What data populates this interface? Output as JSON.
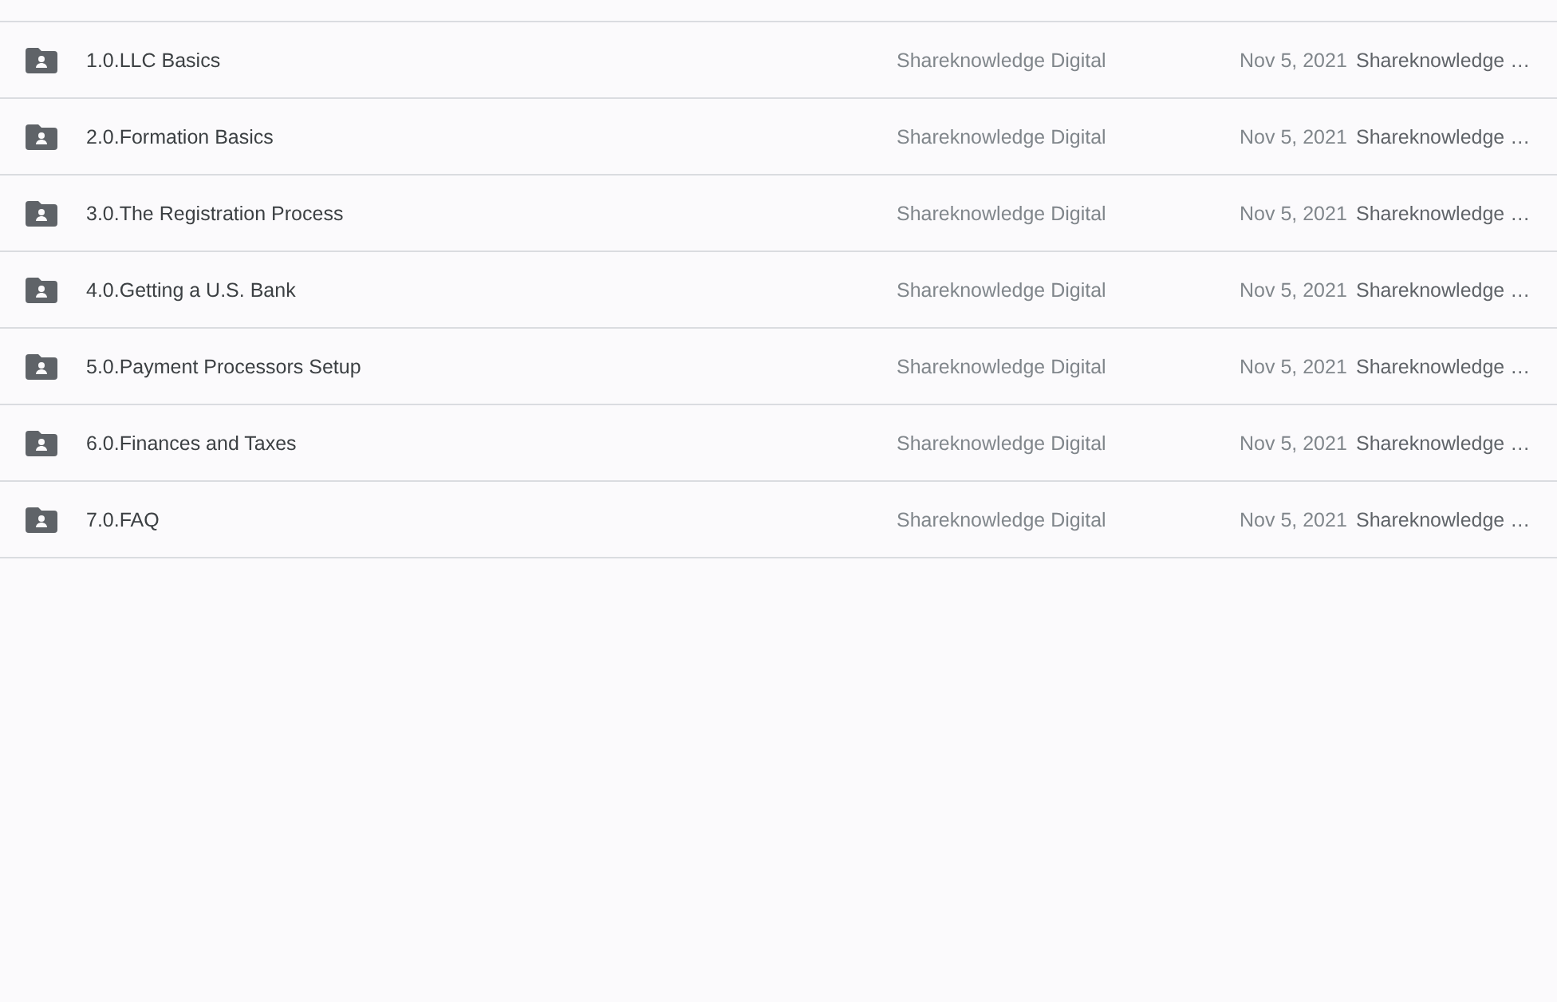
{
  "rows": [
    {
      "name": "1.0.LLC Basics",
      "owner": "Shareknowledge Digital",
      "date": "Nov 5, 2021",
      "modified_by": "Shareknowledge …"
    },
    {
      "name": "2.0.Formation Basics",
      "owner": "Shareknowledge Digital",
      "date": "Nov 5, 2021",
      "modified_by": "Shareknowledge …"
    },
    {
      "name": "3.0.The Registration Process",
      "owner": "Shareknowledge Digital",
      "date": "Nov 5, 2021",
      "modified_by": "Shareknowledge …"
    },
    {
      "name": "4.0.Getting a U.S. Bank",
      "owner": "Shareknowledge Digital",
      "date": "Nov 5, 2021",
      "modified_by": "Shareknowledge …"
    },
    {
      "name": "5.0.Payment Processors Setup",
      "owner": "Shareknowledge Digital",
      "date": "Nov 5, 2021",
      "modified_by": "Shareknowledge …"
    },
    {
      "name": "6.0.Finances and Taxes",
      "owner": "Shareknowledge Digital",
      "date": "Nov 5, 2021",
      "modified_by": "Shareknowledge …"
    },
    {
      "name": "7.0.FAQ",
      "owner": "Shareknowledge Digital",
      "date": "Nov 5, 2021",
      "modified_by": "Shareknowledge …"
    }
  ]
}
